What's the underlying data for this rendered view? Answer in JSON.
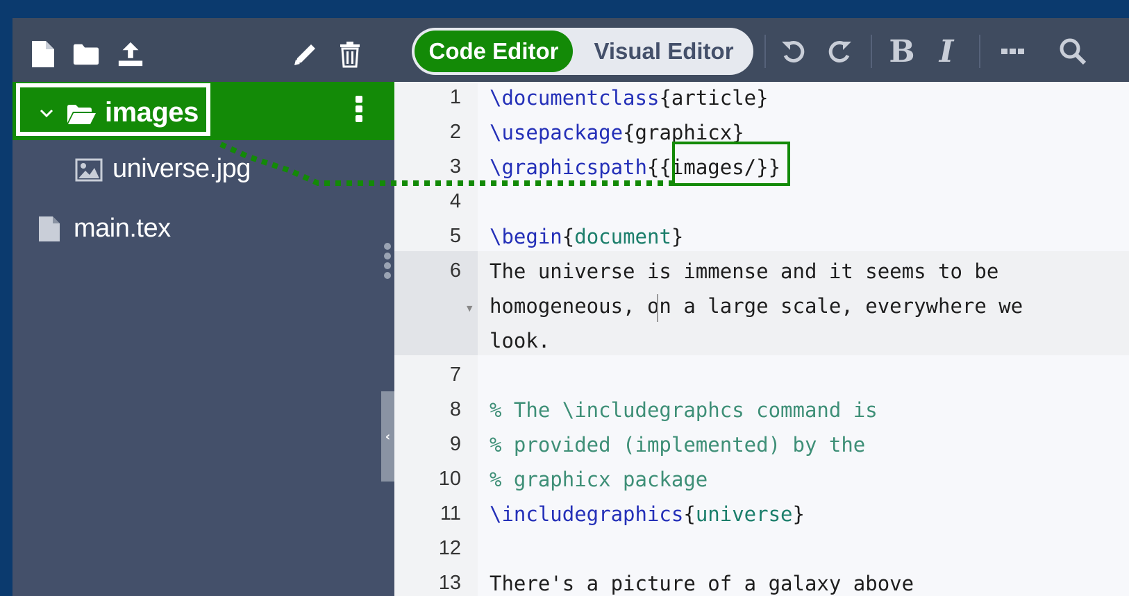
{
  "file_tree": {
    "toolbar": [
      {
        "name": "new-file-icon"
      },
      {
        "name": "new-folder-icon"
      },
      {
        "name": "upload-icon"
      },
      {
        "name": "rename-icon"
      },
      {
        "name": "delete-icon"
      }
    ],
    "folder": {
      "label": "images",
      "icon": "folder-open-icon",
      "expanded": true
    },
    "files": [
      {
        "label": "universe.jpg",
        "icon": "image-file-icon"
      },
      {
        "label": "main.tex",
        "icon": "file-icon"
      }
    ]
  },
  "editor_toolbar": {
    "code_editor_label": "Code Editor",
    "visual_editor_label": "Visual Editor",
    "icons": [
      "undo-icon",
      "redo-icon",
      "bold-icon",
      "italic-icon",
      "more-icon",
      "search-icon"
    ],
    "bold_glyph": "B",
    "italic_glyph": "I"
  },
  "editor": {
    "lines": [
      {
        "number": "1",
        "segments": [
          {
            "t": "\\documentclass",
            "c": "kw"
          },
          {
            "t": "{article}",
            "c": ""
          }
        ]
      },
      {
        "number": "2",
        "segments": [
          {
            "t": "\\usepackage",
            "c": "kw"
          },
          {
            "t": "{graphicx}",
            "c": ""
          }
        ]
      },
      {
        "number": "3",
        "segments": [
          {
            "t": "\\graphicspath",
            "c": "kw"
          },
          {
            "t": "{{images/}}",
            "c": ""
          }
        ]
      },
      {
        "number": "4",
        "segments": []
      },
      {
        "number": "5",
        "segments": [
          {
            "t": "\\begin",
            "c": "kw"
          },
          {
            "t": "{",
            "c": ""
          },
          {
            "t": "document",
            "c": "arg"
          },
          {
            "t": "}",
            "c": ""
          }
        ]
      },
      {
        "number": "6",
        "segments": [
          {
            "t": "The universe is immense and it seems to be",
            "c": ""
          }
        ]
      },
      {
        "number": "",
        "segments": [
          {
            "t": "homogeneous, on a large scale, everywhere we",
            "c": ""
          }
        ]
      },
      {
        "number": "",
        "segments": [
          {
            "t": "look.",
            "c": ""
          }
        ]
      },
      {
        "number": "7",
        "segments": []
      },
      {
        "number": "8",
        "segments": [
          {
            "t": "% The \\includegraphcs command is",
            "c": "com"
          }
        ]
      },
      {
        "number": "9",
        "segments": [
          {
            "t": "% provided (implemented) by the",
            "c": "com"
          }
        ]
      },
      {
        "number": "10",
        "segments": [
          {
            "t": "% graphicx package",
            "c": "com"
          }
        ]
      },
      {
        "number": "11",
        "segments": [
          {
            "t": "\\includegraphics",
            "c": "kw"
          },
          {
            "t": "{",
            "c": ""
          },
          {
            "t": "universe",
            "c": "arg"
          },
          {
            "t": "}",
            "c": ""
          }
        ]
      },
      {
        "number": "12",
        "segments": []
      },
      {
        "number": "13",
        "segments": [
          {
            "t": "There's a picture of a galaxy above",
            "c": ""
          }
        ]
      }
    ]
  },
  "colors": {
    "accent_green": "#138a07",
    "sidebar_bg": "#44506a",
    "outer_bg": "#0b3a6e"
  }
}
